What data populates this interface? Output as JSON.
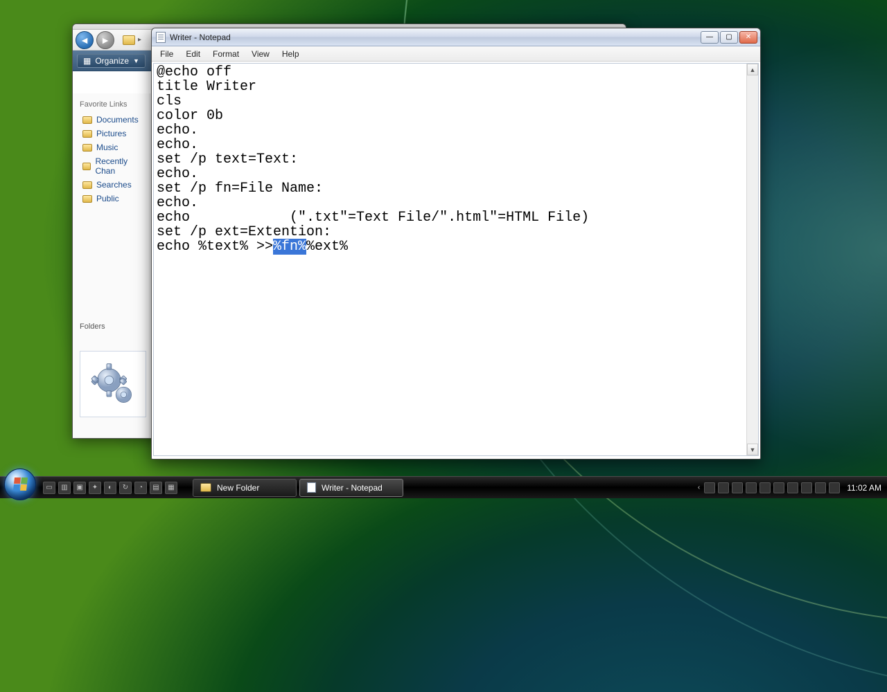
{
  "explorer": {
    "organize_label": "Organize",
    "favorite_links_heading": "Favorite Links",
    "links": [
      "Documents",
      "Pictures",
      "Music",
      "Recently Chan",
      "Searches",
      "Public"
    ],
    "folders_heading": "Folders"
  },
  "notepad": {
    "title": "Writer - Notepad",
    "menus": [
      "File",
      "Edit",
      "Format",
      "View",
      "Help"
    ],
    "content_before_sel": "@echo off\ntitle Writer\ncls\ncolor 0b\necho.\necho.\nset /p text=Text:\necho.\nset /p fn=File Name:\necho.\necho            (\".txt\"=Text File/\".html\"=HTML File)\nset /p ext=Extention:\necho %text% >>",
    "content_selected": "%fn%",
    "content_after_sel": "%ext%"
  },
  "taskbar": {
    "buttons": [
      {
        "label": "New Folder",
        "icon": "folder",
        "active": false
      },
      {
        "label": "Writer - Notepad",
        "icon": "notepad",
        "active": true
      }
    ],
    "clock": "11:02 AM"
  }
}
